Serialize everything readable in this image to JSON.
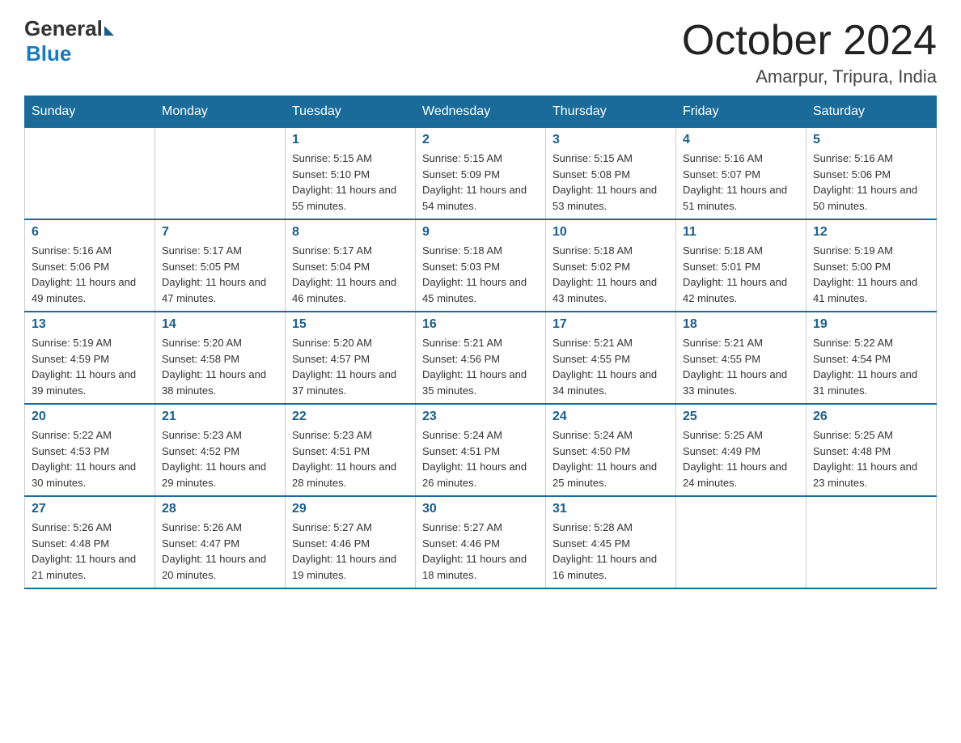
{
  "header": {
    "logo_general": "General",
    "logo_blue": "Blue",
    "month_title": "October 2024",
    "location": "Amarpur, Tripura, India"
  },
  "weekdays": [
    "Sunday",
    "Monday",
    "Tuesday",
    "Wednesday",
    "Thursday",
    "Friday",
    "Saturday"
  ],
  "weeks": [
    [
      {
        "day": "",
        "sunrise": "",
        "sunset": "",
        "daylight": ""
      },
      {
        "day": "",
        "sunrise": "",
        "sunset": "",
        "daylight": ""
      },
      {
        "day": "1",
        "sunrise": "Sunrise: 5:15 AM",
        "sunset": "Sunset: 5:10 PM",
        "daylight": "Daylight: 11 hours and 55 minutes."
      },
      {
        "day": "2",
        "sunrise": "Sunrise: 5:15 AM",
        "sunset": "Sunset: 5:09 PM",
        "daylight": "Daylight: 11 hours and 54 minutes."
      },
      {
        "day": "3",
        "sunrise": "Sunrise: 5:15 AM",
        "sunset": "Sunset: 5:08 PM",
        "daylight": "Daylight: 11 hours and 53 minutes."
      },
      {
        "day": "4",
        "sunrise": "Sunrise: 5:16 AM",
        "sunset": "Sunset: 5:07 PM",
        "daylight": "Daylight: 11 hours and 51 minutes."
      },
      {
        "day": "5",
        "sunrise": "Sunrise: 5:16 AM",
        "sunset": "Sunset: 5:06 PM",
        "daylight": "Daylight: 11 hours and 50 minutes."
      }
    ],
    [
      {
        "day": "6",
        "sunrise": "Sunrise: 5:16 AM",
        "sunset": "Sunset: 5:06 PM",
        "daylight": "Daylight: 11 hours and 49 minutes."
      },
      {
        "day": "7",
        "sunrise": "Sunrise: 5:17 AM",
        "sunset": "Sunset: 5:05 PM",
        "daylight": "Daylight: 11 hours and 47 minutes."
      },
      {
        "day": "8",
        "sunrise": "Sunrise: 5:17 AM",
        "sunset": "Sunset: 5:04 PM",
        "daylight": "Daylight: 11 hours and 46 minutes."
      },
      {
        "day": "9",
        "sunrise": "Sunrise: 5:18 AM",
        "sunset": "Sunset: 5:03 PM",
        "daylight": "Daylight: 11 hours and 45 minutes."
      },
      {
        "day": "10",
        "sunrise": "Sunrise: 5:18 AM",
        "sunset": "Sunset: 5:02 PM",
        "daylight": "Daylight: 11 hours and 43 minutes."
      },
      {
        "day": "11",
        "sunrise": "Sunrise: 5:18 AM",
        "sunset": "Sunset: 5:01 PM",
        "daylight": "Daylight: 11 hours and 42 minutes."
      },
      {
        "day": "12",
        "sunrise": "Sunrise: 5:19 AM",
        "sunset": "Sunset: 5:00 PM",
        "daylight": "Daylight: 11 hours and 41 minutes."
      }
    ],
    [
      {
        "day": "13",
        "sunrise": "Sunrise: 5:19 AM",
        "sunset": "Sunset: 4:59 PM",
        "daylight": "Daylight: 11 hours and 39 minutes."
      },
      {
        "day": "14",
        "sunrise": "Sunrise: 5:20 AM",
        "sunset": "Sunset: 4:58 PM",
        "daylight": "Daylight: 11 hours and 38 minutes."
      },
      {
        "day": "15",
        "sunrise": "Sunrise: 5:20 AM",
        "sunset": "Sunset: 4:57 PM",
        "daylight": "Daylight: 11 hours and 37 minutes."
      },
      {
        "day": "16",
        "sunrise": "Sunrise: 5:21 AM",
        "sunset": "Sunset: 4:56 PM",
        "daylight": "Daylight: 11 hours and 35 minutes."
      },
      {
        "day": "17",
        "sunrise": "Sunrise: 5:21 AM",
        "sunset": "Sunset: 4:55 PM",
        "daylight": "Daylight: 11 hours and 34 minutes."
      },
      {
        "day": "18",
        "sunrise": "Sunrise: 5:21 AM",
        "sunset": "Sunset: 4:55 PM",
        "daylight": "Daylight: 11 hours and 33 minutes."
      },
      {
        "day": "19",
        "sunrise": "Sunrise: 5:22 AM",
        "sunset": "Sunset: 4:54 PM",
        "daylight": "Daylight: 11 hours and 31 minutes."
      }
    ],
    [
      {
        "day": "20",
        "sunrise": "Sunrise: 5:22 AM",
        "sunset": "Sunset: 4:53 PM",
        "daylight": "Daylight: 11 hours and 30 minutes."
      },
      {
        "day": "21",
        "sunrise": "Sunrise: 5:23 AM",
        "sunset": "Sunset: 4:52 PM",
        "daylight": "Daylight: 11 hours and 29 minutes."
      },
      {
        "day": "22",
        "sunrise": "Sunrise: 5:23 AM",
        "sunset": "Sunset: 4:51 PM",
        "daylight": "Daylight: 11 hours and 28 minutes."
      },
      {
        "day": "23",
        "sunrise": "Sunrise: 5:24 AM",
        "sunset": "Sunset: 4:51 PM",
        "daylight": "Daylight: 11 hours and 26 minutes."
      },
      {
        "day": "24",
        "sunrise": "Sunrise: 5:24 AM",
        "sunset": "Sunset: 4:50 PM",
        "daylight": "Daylight: 11 hours and 25 minutes."
      },
      {
        "day": "25",
        "sunrise": "Sunrise: 5:25 AM",
        "sunset": "Sunset: 4:49 PM",
        "daylight": "Daylight: 11 hours and 24 minutes."
      },
      {
        "day": "26",
        "sunrise": "Sunrise: 5:25 AM",
        "sunset": "Sunset: 4:48 PM",
        "daylight": "Daylight: 11 hours and 23 minutes."
      }
    ],
    [
      {
        "day": "27",
        "sunrise": "Sunrise: 5:26 AM",
        "sunset": "Sunset: 4:48 PM",
        "daylight": "Daylight: 11 hours and 21 minutes."
      },
      {
        "day": "28",
        "sunrise": "Sunrise: 5:26 AM",
        "sunset": "Sunset: 4:47 PM",
        "daylight": "Daylight: 11 hours and 20 minutes."
      },
      {
        "day": "29",
        "sunrise": "Sunrise: 5:27 AM",
        "sunset": "Sunset: 4:46 PM",
        "daylight": "Daylight: 11 hours and 19 minutes."
      },
      {
        "day": "30",
        "sunrise": "Sunrise: 5:27 AM",
        "sunset": "Sunset: 4:46 PM",
        "daylight": "Daylight: 11 hours and 18 minutes."
      },
      {
        "day": "31",
        "sunrise": "Sunrise: 5:28 AM",
        "sunset": "Sunset: 4:45 PM",
        "daylight": "Daylight: 11 hours and 16 minutes."
      },
      {
        "day": "",
        "sunrise": "",
        "sunset": "",
        "daylight": ""
      },
      {
        "day": "",
        "sunrise": "",
        "sunset": "",
        "daylight": ""
      }
    ]
  ]
}
